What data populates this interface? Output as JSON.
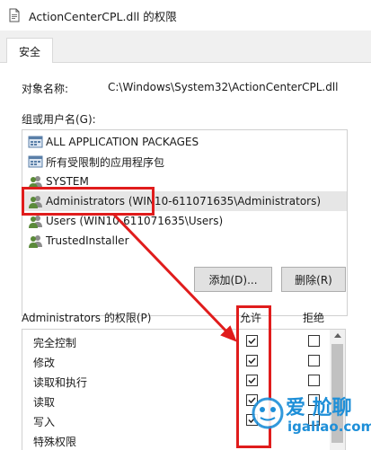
{
  "window": {
    "title": "ActionCenterCPL.dll 的权限"
  },
  "tabs": [
    {
      "label": "安全"
    }
  ],
  "object": {
    "label": "对象名称:",
    "value": "C:\\Windows\\System32\\ActionCenterCPL.dll"
  },
  "group_label": "组或用户名(G):",
  "users": [
    {
      "name": "ALL APPLICATION PACKAGES",
      "icon": "package-icon"
    },
    {
      "name": "所有受限制的应用程序包",
      "icon": "package-icon"
    },
    {
      "name": "SYSTEM",
      "icon": "users-icon"
    },
    {
      "name": "Administrators (WIN10-611071635\\Administrators)",
      "icon": "users-icon",
      "selected": true
    },
    {
      "name": "Users (WIN10-611071635\\Users)",
      "icon": "users-icon"
    },
    {
      "name": "TrustedInstaller",
      "icon": "users-icon"
    }
  ],
  "buttons": {
    "add": "添加(D)...",
    "remove": "删除(R)"
  },
  "permissions": {
    "header": "Administrators 的权限(P)",
    "allow_label": "允许",
    "deny_label": "拒绝",
    "rows": [
      {
        "name": "完全控制",
        "allow": true,
        "deny": false
      },
      {
        "name": "修改",
        "allow": true,
        "deny": false
      },
      {
        "name": "读取和执行",
        "allow": true,
        "deny": false
      },
      {
        "name": "读取",
        "allow": true,
        "deny": false
      },
      {
        "name": "写入",
        "allow": true,
        "deny": false
      },
      {
        "name": "特殊权限",
        "allow": false,
        "deny": false
      }
    ]
  },
  "watermark": {
    "text": "爱 尬聊",
    "url": "igaliao.com"
  },
  "colors": {
    "highlight": "#e01c1c",
    "selection": "#e6e6e6"
  }
}
